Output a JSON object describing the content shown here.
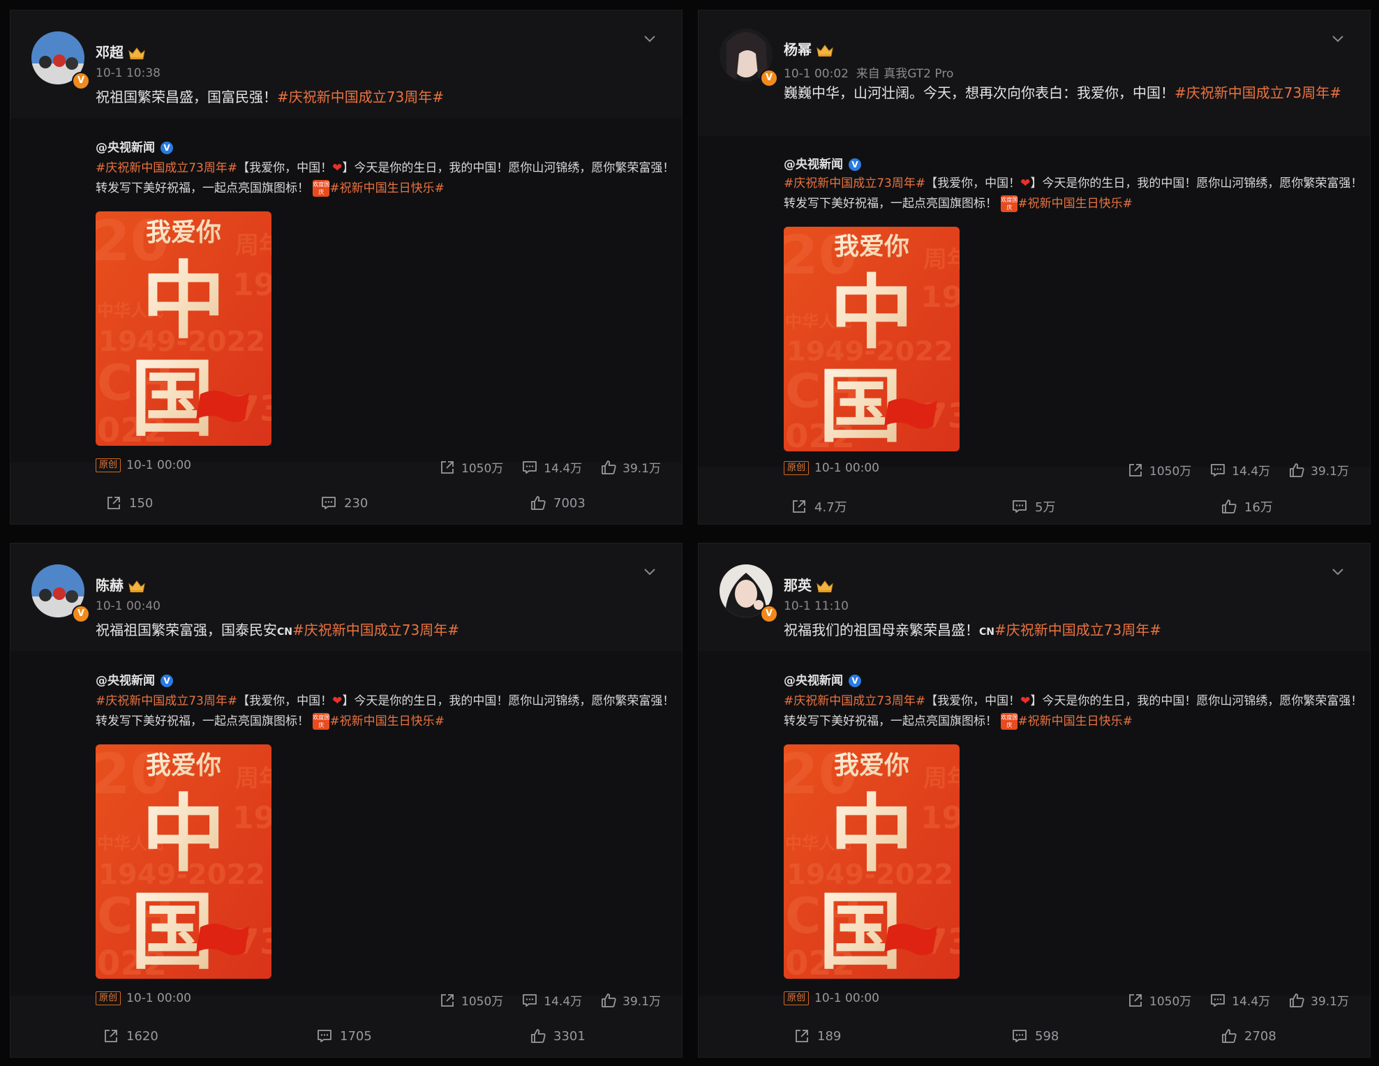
{
  "posts": [
    {
      "author": "邓超",
      "time": "10-1 10:38",
      "text": "祝祖国繁荣昌盛，国富民强！",
      "hashtag": "#庆祝新中国成立73周年#",
      "retweet": {
        "author": "@央视新闻",
        "tag1": "#庆祝新中国成立73周年#",
        "body1": "【我爱你，中国！",
        "heart": "❤",
        "body2": "】今天是你的生日，我的中国！愿你山河锦绣，愿你繁荣富强！转发写下美好祝福，一起点亮国旗图标！",
        "mini": "欢度国庆",
        "tag2": "#祝新中国生日快乐#",
        "poster": {
          "top": "我爱你",
          "c1": "中",
          "c2": "国"
        },
        "badge": "原创",
        "time": "10-1 00:00",
        "reposts": "1050万",
        "comments": "14.4万",
        "likes": "39.1万"
      },
      "reposts": "150",
      "comments": "230",
      "likes": "7003"
    },
    {
      "author": "杨幂",
      "time": "10-1 00:02",
      "source": "来自 真我GT2 Pro",
      "text": "巍巍中华，山河壮阔。今天，想再次向你表白：我爱你，中国！",
      "hashtag": "#庆祝新中国成立73周年#",
      "retweet": {
        "author": "@央视新闻",
        "tag1": "#庆祝新中国成立73周年#",
        "body1": "【我爱你，中国！",
        "heart": "❤",
        "body2": "】今天是你的生日，我的中国！愿你山河锦绣，愿你繁荣富强！转发写下美好祝福，一起点亮国旗图标！",
        "mini": "欢度国庆",
        "tag2": "#祝新中国生日快乐#",
        "poster": {
          "top": "我爱你",
          "c1": "中",
          "c2": "国"
        },
        "badge": "原创",
        "time": "10-1 00:00",
        "reposts": "1050万",
        "comments": "14.4万",
        "likes": "39.1万"
      },
      "reposts": "4.7万",
      "comments": "5万",
      "likes": "16万"
    },
    {
      "author": "陈赫",
      "time": "10-1 00:40",
      "text": "祝福祖国繁荣富强，国泰民安",
      "cn": "CN",
      "hashtag": "#庆祝新中国成立73周年#",
      "retweet": {
        "author": "@央视新闻",
        "tag1": "#庆祝新中国成立73周年#",
        "body1": "【我爱你，中国！",
        "heart": "❤",
        "body2": "】今天是你的生日，我的中国！愿你山河锦绣，愿你繁荣富强！转发写下美好祝福，一起点亮国旗图标！",
        "mini": "欢度国庆",
        "tag2": "#祝新中国生日快乐#",
        "poster": {
          "top": "我爱你",
          "c1": "中",
          "c2": "国"
        },
        "badge": "原创",
        "time": "10-1 00:00",
        "reposts": "1050万",
        "comments": "14.4万",
        "likes": "39.1万"
      },
      "reposts": "1620",
      "comments": "1705",
      "likes": "3301"
    },
    {
      "author": "那英",
      "time": "10-1 11:10",
      "text": "祝福我们的祖国母亲繁荣昌盛！",
      "cn": "CN",
      "hashtag": "#庆祝新中国成立73周年#",
      "retweet": {
        "author": "@央视新闻",
        "tag1": "#庆祝新中国成立73周年#",
        "body1": "【我爱你，中国！",
        "heart": "❤",
        "body2": "】今天是你的生日，我的中国！愿你山河锦绣，愿你繁荣富强！转发写下美好祝福，一起点亮国旗图标！",
        "mini": "欢度国庆",
        "tag2": "#祝新中国生日快乐#",
        "poster": {
          "top": "我爱你",
          "c1": "中",
          "c2": "国"
        },
        "badge": "原创",
        "time": "10-1 00:00",
        "reposts": "1050万",
        "comments": "14.4万",
        "likes": "39.1万"
      },
      "reposts": "189",
      "comments": "598",
      "likes": "2708"
    }
  ],
  "icons": {
    "repost": "repost-icon",
    "comment": "comment-icon",
    "like": "like-icon",
    "more": "chevron-down-icon",
    "crown": "crown-icon"
  },
  "colors": {
    "background": "#070708",
    "card": "#141416",
    "hashtag": "#eb7340",
    "verified_orange": "#f08a1c",
    "verified_blue": "#2a7be0",
    "poster_red": "#e84b1f"
  }
}
